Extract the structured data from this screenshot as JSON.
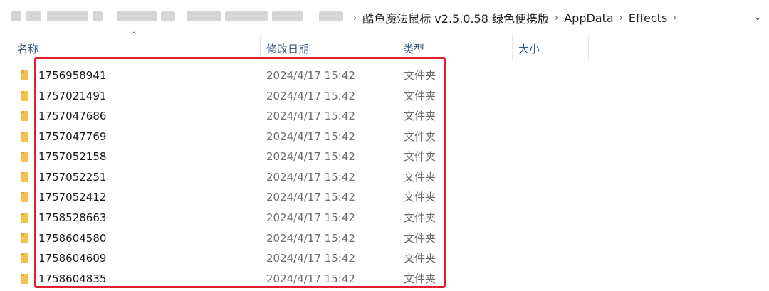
{
  "address_bar": {
    "crumbs": [
      "酷鱼魔法鼠标 v2.5.0.58 绿色便携版",
      "AppData",
      "Effects"
    ],
    "separator": "›",
    "dropdown_glyph": "⌄"
  },
  "columns": {
    "name": "名称",
    "date_modified": "修改日期",
    "type": "类型",
    "size": "大小",
    "sort_indicator": "^"
  },
  "rows": [
    {
      "name": "1756958941",
      "date": "2024/4/17 15:42",
      "type": "文件夹"
    },
    {
      "name": "1757021491",
      "date": "2024/4/17 15:42",
      "type": "文件夹"
    },
    {
      "name": "1757047686",
      "date": "2024/4/17 15:42",
      "type": "文件夹"
    },
    {
      "name": "1757047769",
      "date": "2024/4/17 15:42",
      "type": "文件夹"
    },
    {
      "name": "1757052158",
      "date": "2024/4/17 15:42",
      "type": "文件夹"
    },
    {
      "name": "1757052251",
      "date": "2024/4/17 15:42",
      "type": "文件夹"
    },
    {
      "name": "1757052412",
      "date": "2024/4/17 15:42",
      "type": "文件夹"
    },
    {
      "name": "1758528663",
      "date": "2024/4/17 15:42",
      "type": "文件夹"
    },
    {
      "name": "1758604580",
      "date": "2024/4/17 15:42",
      "type": "文件夹"
    },
    {
      "name": "1758604609",
      "date": "2024/4/17 15:42",
      "type": "文件夹"
    },
    {
      "name": "1758604835",
      "date": "2024/4/17 15:42",
      "type": "文件夹"
    }
  ],
  "icons": {
    "folder": "folder-icon"
  },
  "colors": {
    "highlight": "#e0202a",
    "folder": "#f2c14e",
    "header_text": "#3b5b80"
  }
}
